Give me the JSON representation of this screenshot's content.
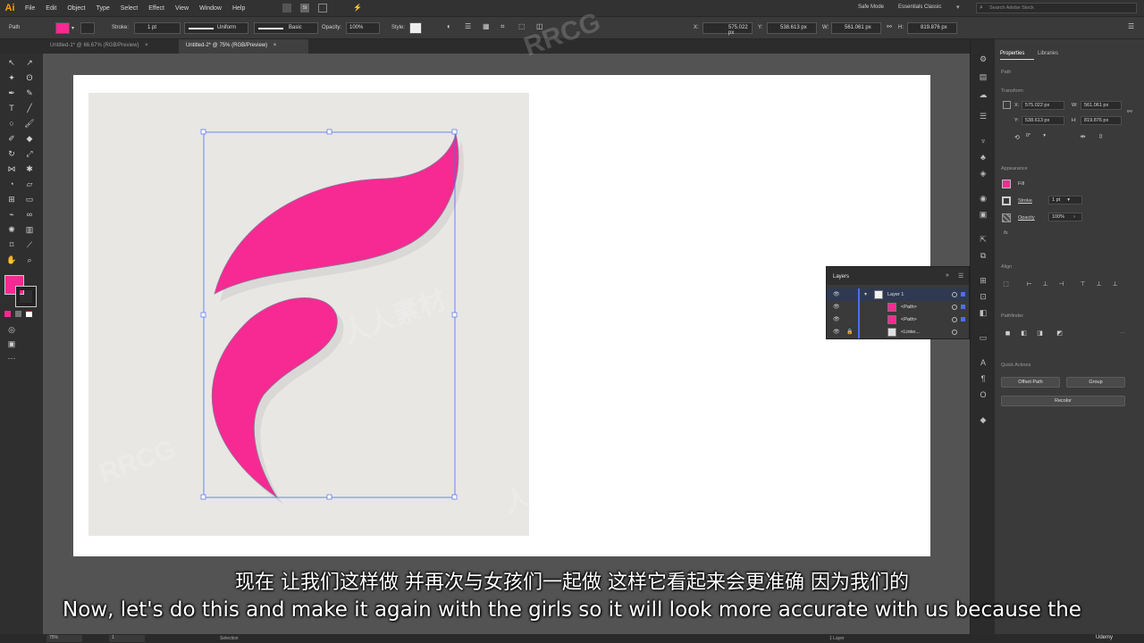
{
  "app": {
    "logo": "Ai"
  },
  "menu": [
    "File",
    "Edit",
    "Object",
    "Type",
    "Select",
    "Effect",
    "View",
    "Window",
    "Help"
  ],
  "menu_right": {
    "safe_mode": "Safe Mode",
    "workspace": "Essentials Classic",
    "search_placeholder": "Search Adobe Stock"
  },
  "control": {
    "selection": "Path",
    "stroke_label": "Stroke:",
    "stroke_value": "1 pt",
    "profile": "Uniform",
    "brush": "Basic",
    "opacity_label": "Opacity:",
    "opacity_value": "100%",
    "style_label": "Style:",
    "x_label": "X:",
    "x_value": "575.022 px",
    "y_label": "Y:",
    "y_value": "538.613 px",
    "w_label": "W:",
    "w_value": "561.061 px",
    "h_label": "H:",
    "h_value": "819.876 px"
  },
  "tabs": [
    {
      "label": "Untitled-1* @ 66.67% (RGB/Preview)",
      "active": false
    },
    {
      "label": "Untitled-2* @ 75% (RGB/Preview)",
      "active": true
    }
  ],
  "properties": {
    "tabs": [
      "Properties",
      "Libraries"
    ],
    "kind": "Path",
    "transform": "Transform",
    "x_label": "X:",
    "x_value": "575.022 px",
    "y_label": "Y:",
    "y_value": "538.613 px",
    "w_label": "W:",
    "w_value": "561.061 px",
    "h_label": "H:",
    "h_value": "819.876 px",
    "angle": "0°",
    "appearance": "Appearance",
    "fill_label": "Fill",
    "stroke_label": "Stroke",
    "stroke_value": "1 pt",
    "opacity_label": "Opacity",
    "opacity_value": "100%",
    "fx": "fx.",
    "align": "Align",
    "pathfinder": "Pathfinder",
    "quick_actions": "Quick Actions",
    "offset_path": "Offset Path",
    "group": "Group",
    "recolor": "Recolor"
  },
  "layers": {
    "title": "Layers",
    "rows": [
      {
        "name": "Layer 1"
      },
      {
        "name": "<Path>"
      },
      {
        "name": "<Path>"
      },
      {
        "name": "<Linke..."
      }
    ]
  },
  "status": {
    "zoom": "75%",
    "artboard": "1",
    "tool": "Selection",
    "layers_count": "1 Layer"
  },
  "subtitles": {
    "zh": "现在 让我们这样做 并再次与女孩们一起做 这样它看起来会更准确 因为我们的",
    "en": "Now, let's do this and make it again with the girls so it will look more accurate with us because the"
  },
  "watermark": {
    "brand": "RRCG",
    "cn": "人人素材",
    "udemy": "Udemy"
  },
  "colors": {
    "fill": "#f62a92",
    "accent": "#4f6cf0",
    "ui_bg": "#323232"
  }
}
